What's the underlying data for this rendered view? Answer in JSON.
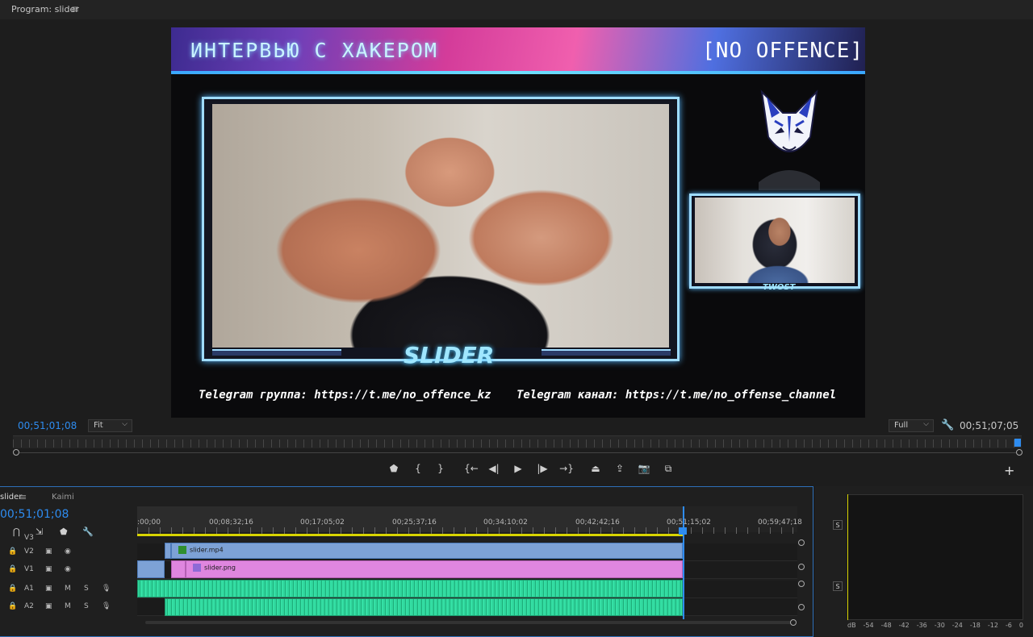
{
  "program_monitor": {
    "title": "Program: slider",
    "menu_icon": "hamburger-icon",
    "current_timecode": "00;51;01;08",
    "duration_timecode": "00;51;07;05",
    "fit_dropdown": "Fit",
    "quality_dropdown": "Full"
  },
  "video_frame": {
    "banner_left": "ИНТЕРВЬЮ С ХАКЕРОМ",
    "banner_right": "[NO OFFENCE]",
    "name_label": "SLIDER",
    "guest_label": "TWOST",
    "telegram_group": "Telegram группа: https://t.me/no_offence_kz",
    "telegram_channel": "Telegram канал: https://t.me/no_offense_channel"
  },
  "transport_controls": [
    {
      "name": "add-marker-button",
      "icon": "marker-icon",
      "glyph": "⬟"
    },
    {
      "name": "mark-in-button",
      "icon": "mark-in-icon",
      "glyph": "{"
    },
    {
      "name": "mark-out-button",
      "icon": "mark-out-icon",
      "glyph": "}"
    },
    {
      "name": "go-to-in-button",
      "icon": "go-to-in-icon",
      "glyph": "{←"
    },
    {
      "name": "step-back-button",
      "icon": "step-back-icon",
      "glyph": "◀|"
    },
    {
      "name": "play-button",
      "icon": "play-icon",
      "glyph": "▶"
    },
    {
      "name": "step-forward-button",
      "icon": "step-forward-icon",
      "glyph": "|▶"
    },
    {
      "name": "go-to-out-button",
      "icon": "go-to-out-icon",
      "glyph": "→}"
    },
    {
      "name": "lift-button",
      "icon": "lift-icon",
      "glyph": "⏏"
    },
    {
      "name": "extract-button",
      "icon": "extract-icon",
      "glyph": "⇪"
    },
    {
      "name": "export-frame-button",
      "icon": "camera-icon",
      "glyph": "📷"
    },
    {
      "name": "comparison-view-button",
      "icon": "comparison-icon",
      "glyph": "⧉"
    }
  ],
  "timeline": {
    "tabs": [
      "slider",
      "Kaimi"
    ],
    "timecode": "00;51;01;08",
    "ruler_labels": [
      ":00;00",
      "00;08;32;16",
      "00;17;05;02",
      "00;25;37;16",
      "00;34;10;02",
      "00;42;42;16",
      "00;51;15;02",
      "00;59;47;18"
    ],
    "tracks": [
      {
        "id": "V3",
        "label": "V3"
      },
      {
        "id": "V2",
        "label": "V2"
      },
      {
        "id": "V1",
        "label": "V1"
      },
      {
        "id": "A1",
        "label": "A1",
        "m": "M",
        "s": "S"
      },
      {
        "id": "A2",
        "label": "A2",
        "m": "M",
        "s": "S"
      }
    ],
    "clips": {
      "v2": "slider.mp4",
      "v1": "slider.png"
    }
  },
  "audio_meter": {
    "solo_labels": [
      "S",
      "S"
    ],
    "scale": [
      "dB",
      "-54",
      "-48",
      "-42",
      "-36",
      "-30",
      "-24",
      "-18",
      "-12",
      "-6",
      "0"
    ]
  },
  "colors": {
    "accent_blue": "#2e8cf0",
    "video_clip": "#7da2d6",
    "graphic_clip": "#df86df",
    "audio_clip": "#2fd49b",
    "work_area": "#d8d400"
  }
}
